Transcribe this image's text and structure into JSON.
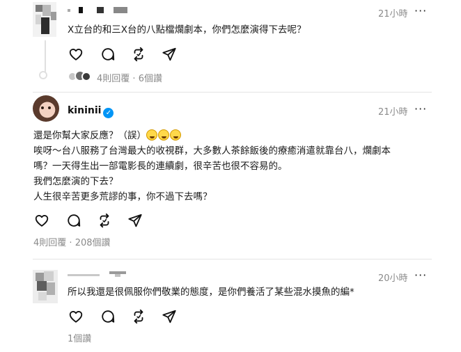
{
  "posts": [
    {
      "time": "21小時",
      "more": "···",
      "text": "X立台的和三X台的八點檔爛劇本，你們怎麼演得下去呢？",
      "replies_label": "4則回覆",
      "dot": "·",
      "likes_label": "6個讚"
    },
    {
      "username": "kininii",
      "verified_mark": "✓",
      "time": "21小時",
      "more": "···",
      "lines": [
        "還是你幫大家反應？（誤）",
        "唉呀～台八服務了台灣最大的收視群，大多數人茶餘飯後的療癒消遣就靠台八，爛劇本",
        "嗎？一天得生出一部電影長的連續劇，很辛苦也很不容易的。",
        "我們怎麼演的下去？",
        "人生很辛苦更多荒謬的事，你不過下去嗎？"
      ],
      "emoji_count": 3,
      "emoji_name": "rolling-on-floor-laughing",
      "replies_label": "4則回覆",
      "dot": "·",
      "likes_label": "208個讚"
    },
    {
      "time": "20小時",
      "more": "···",
      "text": "所以我還是很佩服你們敬業的態度，是你們養活了某些混水摸魚的編*",
      "likes_label": "1個讚"
    }
  ],
  "actions": [
    "like-icon",
    "comment-icon",
    "repost-icon",
    "share-icon"
  ]
}
